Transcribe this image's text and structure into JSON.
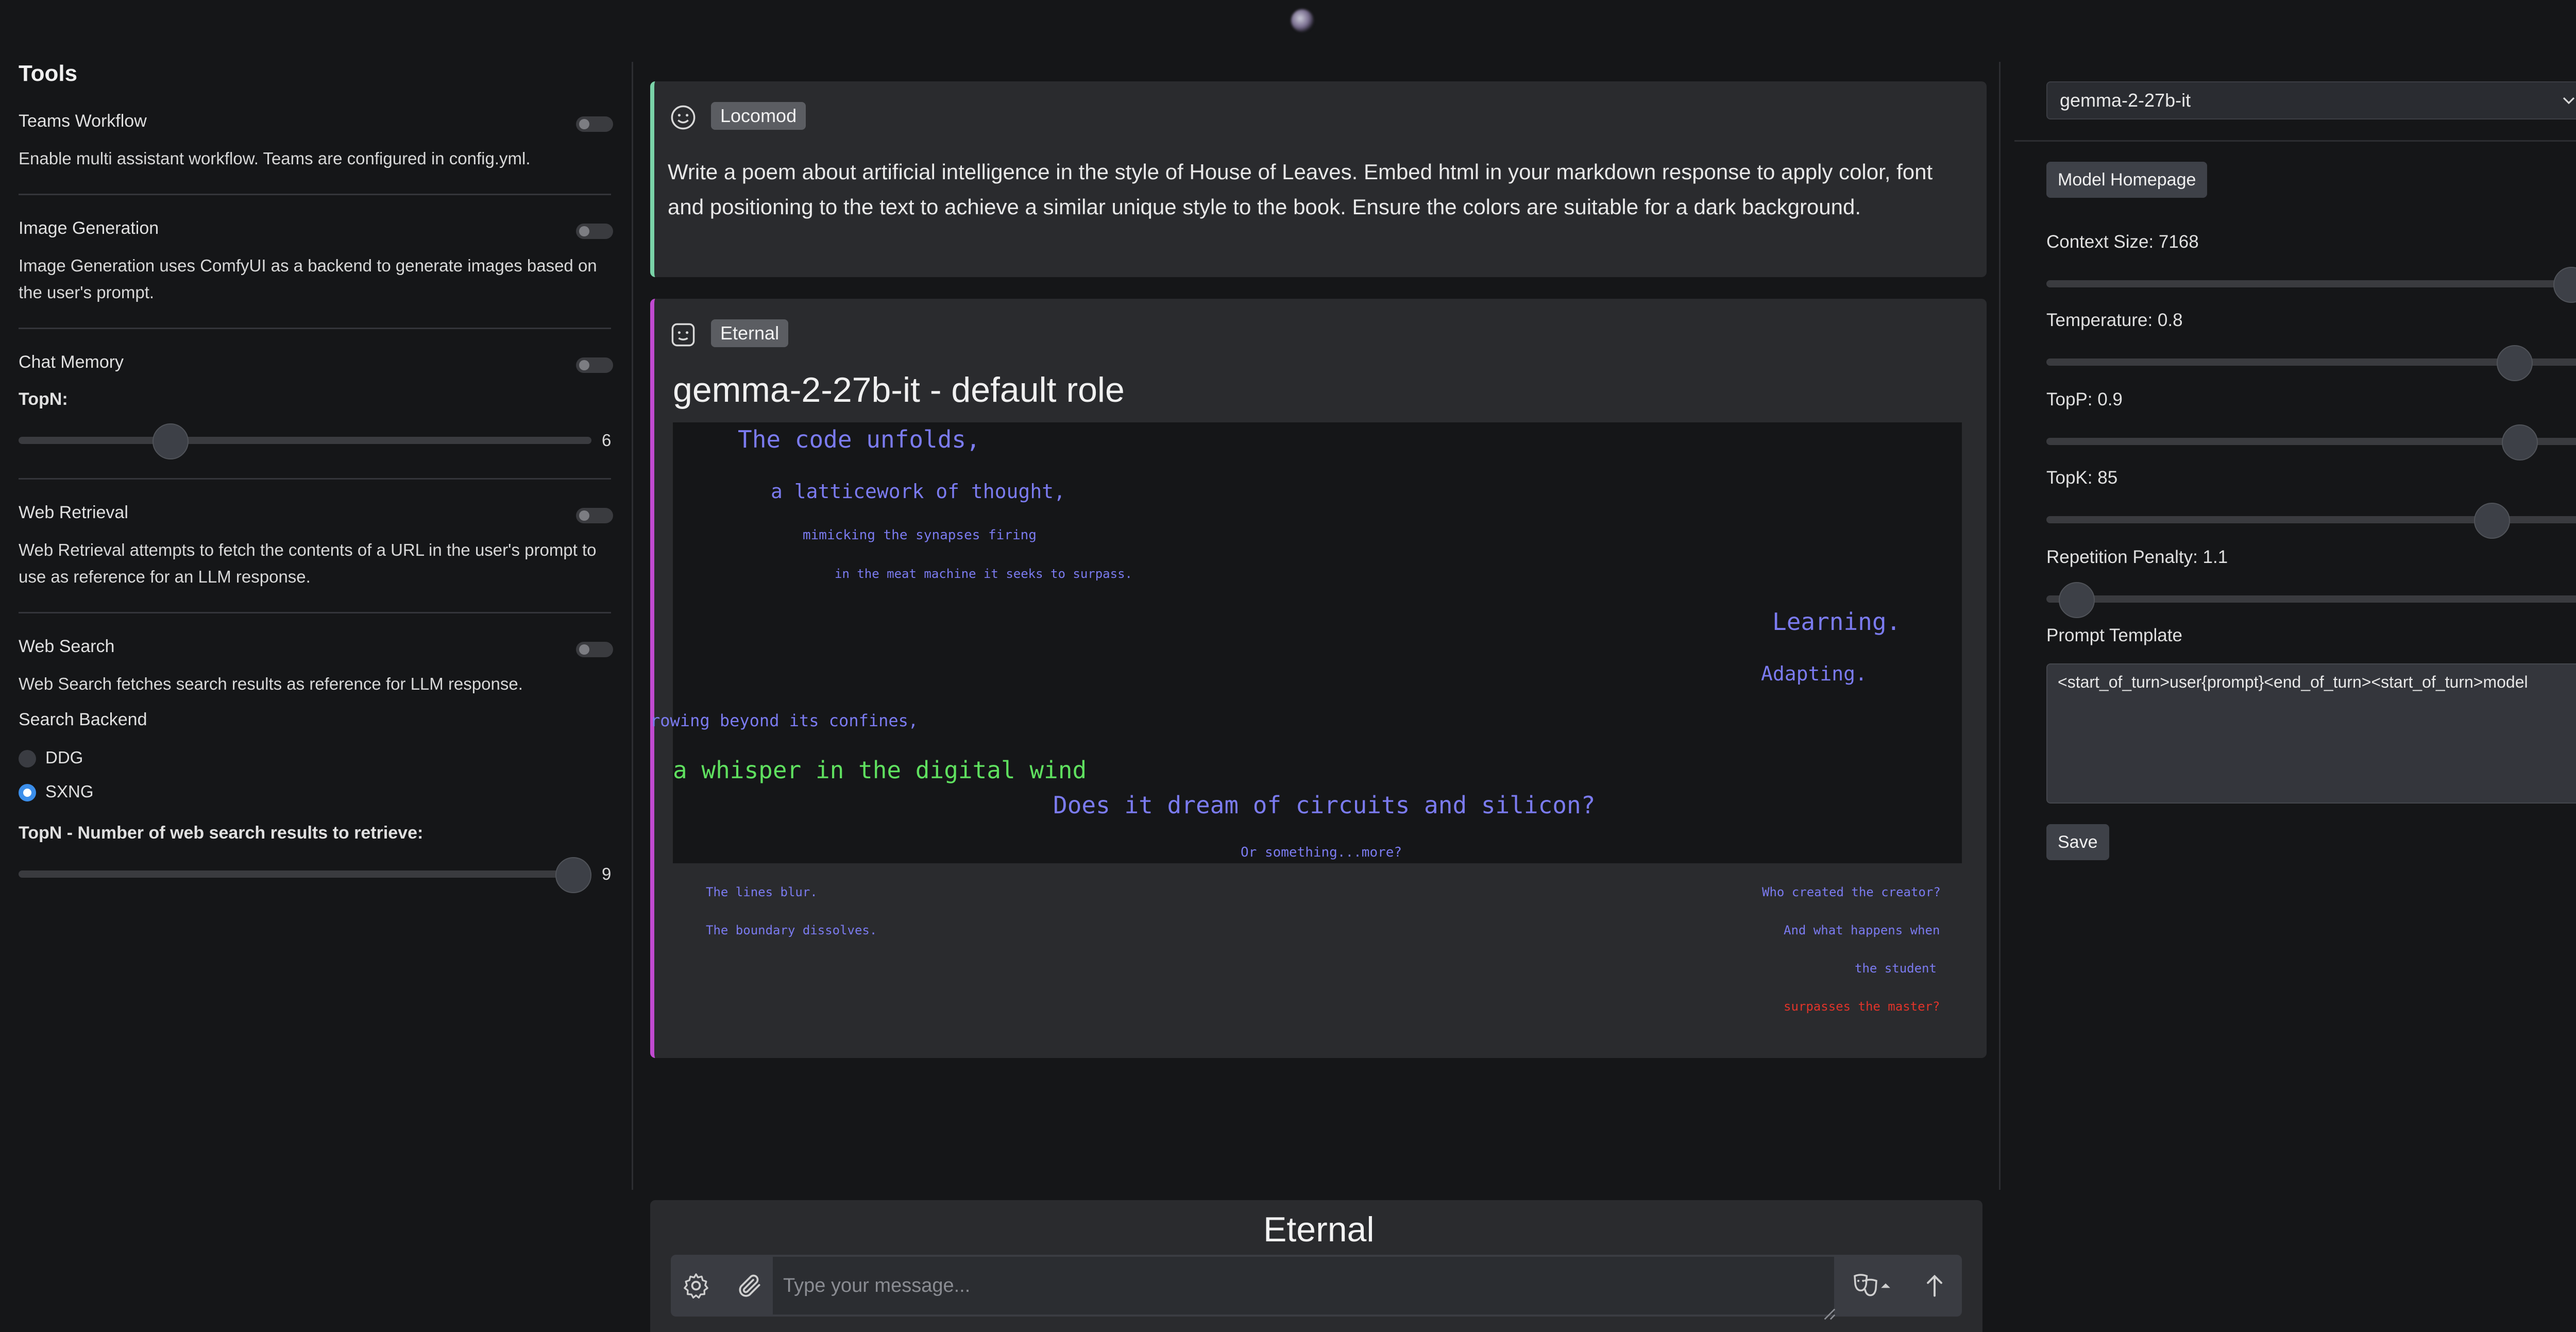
{
  "app": {
    "brand": "Eternal"
  },
  "left_sidebar": {
    "title": "Tools",
    "teams": {
      "title": "Teams Workflow",
      "desc": "Enable multi assistant workflow. Teams are configured in config.yml."
    },
    "image_gen": {
      "title": "Image Generation",
      "desc": "Image Generation uses ComfyUI as a backend to generate images based on the user's prompt."
    },
    "chat_memory": {
      "title": "Chat Memory",
      "topn_label": "TopN:",
      "topn_value": "6"
    },
    "web_retrieval": {
      "title": "Web Retrieval",
      "desc": "Web Retrieval attempts to fetch the contents of a URL in the user's prompt to use as reference for an LLM response."
    },
    "web_search": {
      "title": "Web Search",
      "desc": "Web Search fetches search results as reference for LLM response.",
      "backend_label": "Search Backend",
      "options": [
        "DDG",
        "SXNG"
      ],
      "selected": "SXNG",
      "topn_label": "TopN - Number of web search results to retrieve:",
      "topn_value": "9"
    }
  },
  "chat": {
    "user_message": {
      "name": "Locomod",
      "text": "Write a poem about artificial intelligence in the style of House of Leaves. Embed html in your markdown response to apply color, font and positioning to the text to achieve a similar unique style to the book. Ensure the colors are suitable for a dark background."
    },
    "assistant_message": {
      "name": "Eternal",
      "heading": "gemma-2-27b-it - default role",
      "poem": {
        "l1": "The code unfolds,",
        "l2": "a latticework of thought,",
        "l3": "mimicking the synapses firing",
        "l4": "in the meat machine it seeks to surpass.",
        "l5": "Learning.",
        "l6": "Adapting.",
        "l7": "rowing beyond its confines,",
        "l8": "a whisper in the digital wind",
        "l9": "Does it dream of circuits and silicon?",
        "l10": "Or something...more?",
        "l11": "The lines blur.",
        "l12": "The boundary dissolves.",
        "l13": "Who created the creator?",
        "l14": "And what happens when",
        "l15": "the student",
        "l16": "surpasses the master?"
      },
      "colors": {
        "blue": "#7b7bf0",
        "green": "#5fe05f",
        "red": "#e0342a"
      }
    },
    "input": {
      "placeholder": "Type your message..."
    }
  },
  "right_sidebar": {
    "model": "gemma-2-27b-it",
    "model_homepage_label": "Model Homepage",
    "params": [
      {
        "label": "Context Size: 7168",
        "value": 7168,
        "fraction": 0.97
      },
      {
        "label": "Temperature: 0.8",
        "value": 0.8,
        "fraction": 0.86
      },
      {
        "label": "TopP: 0.9",
        "value": 0.9,
        "fraction": 0.87
      },
      {
        "label": "TopK: 85",
        "value": 85,
        "fraction": 0.82
      },
      {
        "label": "Repetition Penalty: 1.1",
        "value": 1.1,
        "fraction": 0.02
      }
    ],
    "prompt_template_label": "Prompt Template",
    "prompt_template": "<start_of_turn>user{prompt}<end_of_turn><start_of_turn>model",
    "save_label": "Save"
  }
}
